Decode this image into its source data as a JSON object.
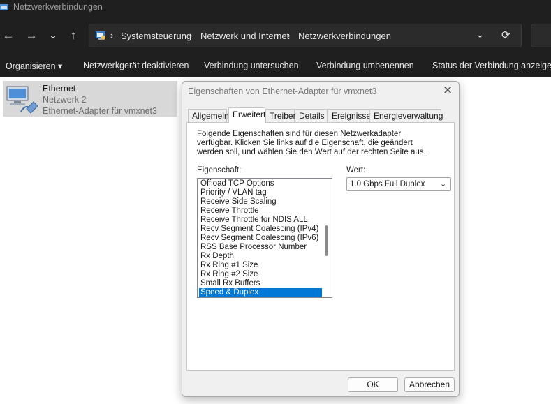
{
  "window": {
    "title": "Netzwerkverbindungen"
  },
  "nav": {
    "back": "←",
    "forward": "→",
    "recent": "⌄",
    "up": "↑"
  },
  "address": {
    "crumbs": [
      "Systemsteuerung",
      "Netzwerk und Internet",
      "Netzwerkverbindungen"
    ],
    "separator": "›",
    "first_separator": "›"
  },
  "commands": {
    "organize": "Organisieren ▾",
    "disable": "Netzwerkgerät deaktivieren",
    "diagnose": "Verbindung untersuchen",
    "rename": "Verbindung umbenennen",
    "status": "Status der Verbindung anzeigen"
  },
  "connection": {
    "name": "Ethernet",
    "network": "Netzwerk 2",
    "adapter": "Ethernet-Adapter für vmxnet3",
    "icon": "network-adapter-icon"
  },
  "dialog": {
    "title": "Eigenschaften von Ethernet-Adapter für vmxnet3",
    "tabs": [
      "Allgemein",
      "Erweitert",
      "Treiber",
      "Details",
      "Ereignisse",
      "Energieverwaltung"
    ],
    "active_tab": "Erweitert",
    "description": "Folgende Eigenschaften sind für diesen Netzwerkadapter verfügbar. Klicken Sie links auf die Eigenschaft, die geändert werden soll, und wählen Sie den Wert auf der rechten Seite aus.",
    "property_label": "Eigenschaft:",
    "value_label": "Wert:",
    "properties": [
      "Offload TCP Options",
      "Priority / VLAN tag",
      "Receive Side Scaling",
      "Receive Throttle",
      "Receive Throttle for NDIS ALL",
      "Recv Segment Coalescing (IPv4)",
      "Recv Segment Coalescing (IPv6)",
      "RSS Base Processor Number",
      "Rx Depth",
      "Rx Ring #1 Size",
      "Rx Ring #2 Size",
      "Small Rx Buffers",
      "Speed & Duplex"
    ],
    "selected_property": "Speed & Duplex",
    "value": "1.0 Gbps Full Duplex",
    "ok": "OK",
    "cancel": "Abbrechen"
  },
  "colors": {
    "chrome": "#1f1f1f",
    "selection": "#0078d7",
    "item_highlight": "#d8d8d8"
  }
}
